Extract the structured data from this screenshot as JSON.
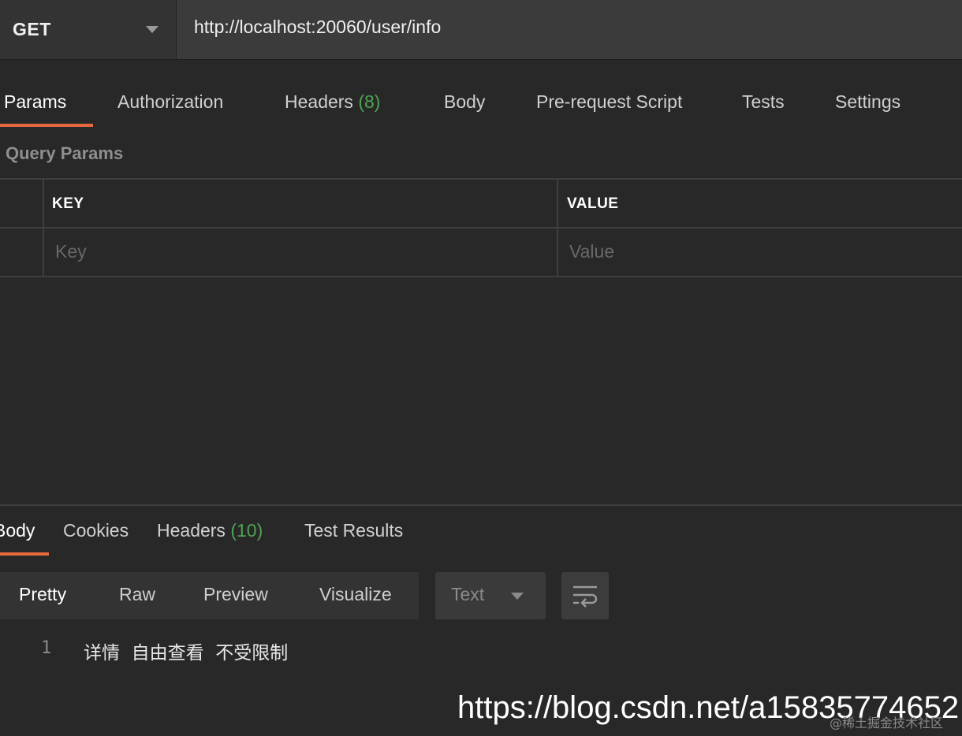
{
  "request": {
    "method": "GET",
    "url": "http://localhost:20060/user/info"
  },
  "request_tabs": [
    {
      "label": "Params",
      "count": ""
    },
    {
      "label": "Authorization",
      "count": ""
    },
    {
      "label": "Headers",
      "count": "(8)"
    },
    {
      "label": "Body",
      "count": ""
    },
    {
      "label": "Pre-request Script",
      "count": ""
    },
    {
      "label": "Tests",
      "count": ""
    },
    {
      "label": "Settings",
      "count": ""
    }
  ],
  "params": {
    "section_title": "Query Params",
    "columns": [
      "KEY",
      "VALUE"
    ],
    "key_placeholder": "Key",
    "value_placeholder": "Value"
  },
  "response_tabs": [
    {
      "label": "Body",
      "count": ""
    },
    {
      "label": "Cookies",
      "count": ""
    },
    {
      "label": "Headers",
      "count": "(10)"
    },
    {
      "label": "Test Results",
      "count": ""
    }
  ],
  "view_modes": [
    "Pretty",
    "Raw",
    "Preview",
    "Visualize"
  ],
  "format": "Text",
  "response_body": {
    "line_numbers": [
      "1"
    ],
    "lines": [
      "详情  自由查看  不受限制"
    ]
  },
  "watermark": {
    "main": "https://blog.csdn.net/a15835774652",
    "sub": "@稀土掘金技术社区"
  },
  "colors": {
    "accent": "#e8683d",
    "count": "#4fa352",
    "background": "#282828"
  }
}
